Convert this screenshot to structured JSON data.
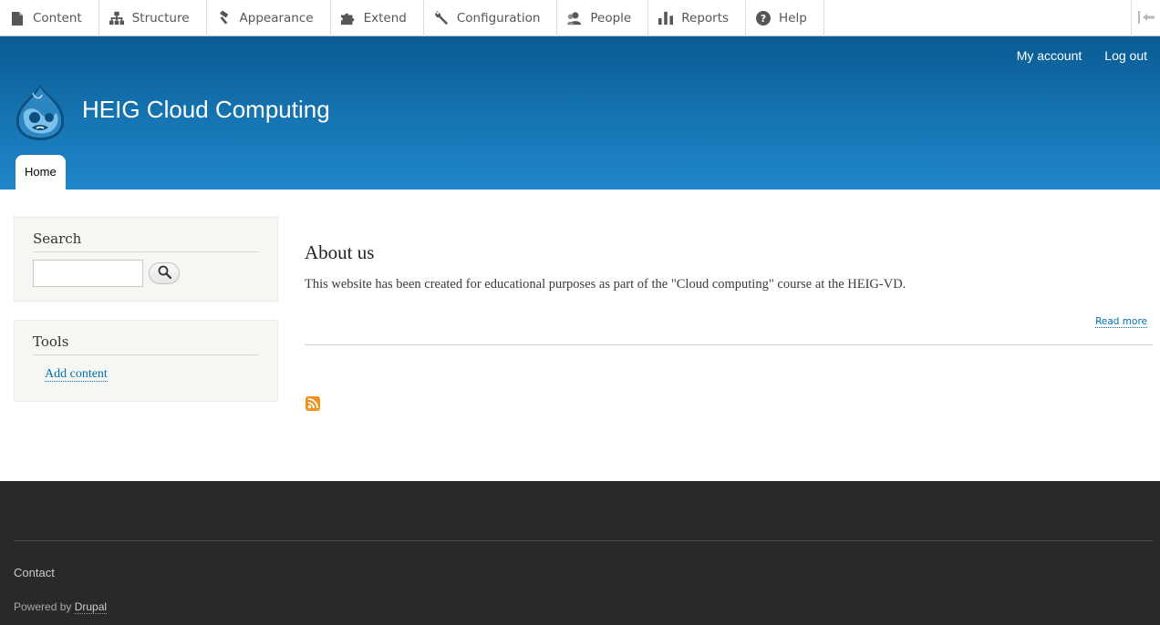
{
  "toolbar": {
    "items": [
      {
        "label": "Content",
        "icon": "content-icon"
      },
      {
        "label": "Structure",
        "icon": "structure-icon"
      },
      {
        "label": "Appearance",
        "icon": "appearance-icon"
      },
      {
        "label": "Extend",
        "icon": "extend-icon"
      },
      {
        "label": "Configuration",
        "icon": "configuration-icon"
      },
      {
        "label": "People",
        "icon": "people-icon"
      },
      {
        "label": "Reports",
        "icon": "reports-icon"
      },
      {
        "label": "Help",
        "icon": "help-icon"
      }
    ],
    "collapse_icon": "collapse-toolbar-icon"
  },
  "header": {
    "site_name": "HEIG Cloud Computing",
    "logo_icon": "drupal-logo-icon",
    "secondary_menu": [
      "My account",
      "Log out"
    ],
    "main_menu": [
      "Home"
    ]
  },
  "sidebar": {
    "search": {
      "title": "Search",
      "input_value": "",
      "button_icon": "search-icon"
    },
    "tools": {
      "title": "Tools",
      "links": [
        "Add content"
      ]
    }
  },
  "main": {
    "article": {
      "title": "About us",
      "body": "This website has been created for educational purposes as part of the \"Cloud computing\" course at the HEIG-VD.",
      "read_more": "Read more"
    },
    "feed_icon": "rss-feed-icon"
  },
  "footer": {
    "contact": "Contact",
    "powered_prefix": "Powered by",
    "powered_link": "Drupal"
  },
  "colors": {
    "header_top": "#0a5b93",
    "header_bottom": "#1f86c9",
    "link": "#0071b3",
    "footer_bg": "#292929",
    "sidebar_bg": "#f6f6f2"
  }
}
